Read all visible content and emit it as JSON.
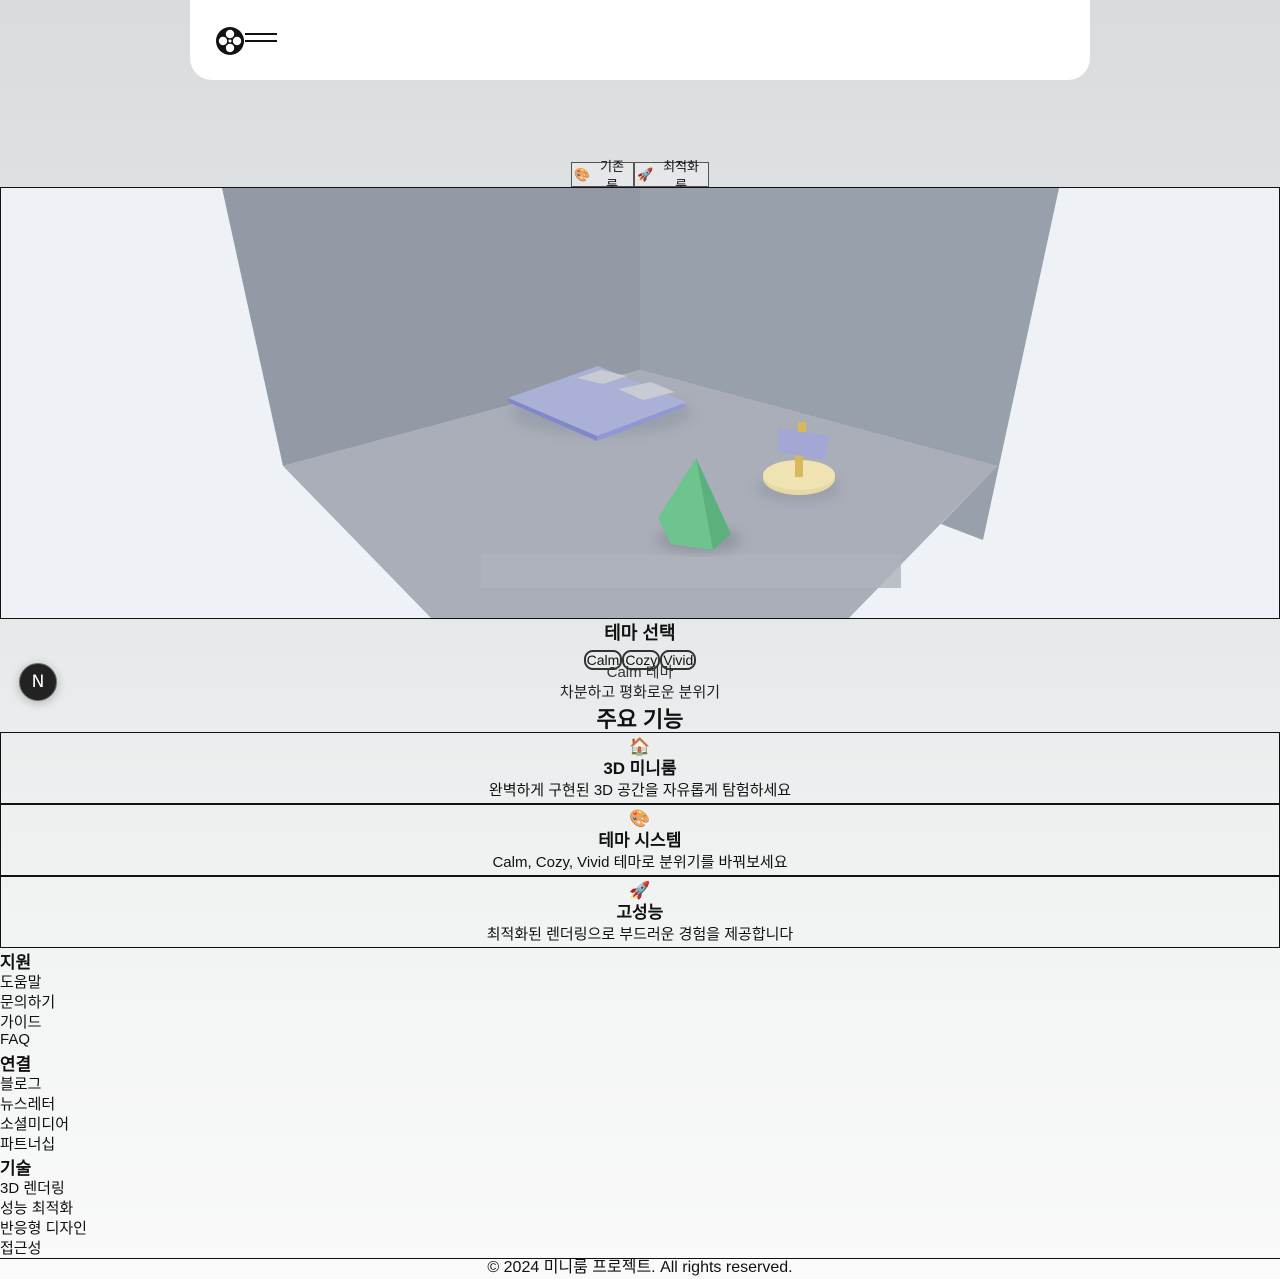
{
  "header": {
    "logo_icon": "film-reel-icon",
    "menu_icon": "hamburger-menu-icon"
  },
  "room_switch": {
    "basic": {
      "icon": "🎨",
      "label": "기존 룸"
    },
    "optimized": {
      "icon": "🚀",
      "label": "최적화 룸"
    }
  },
  "scene": {
    "objects": [
      "bed",
      "cone",
      "lamp"
    ],
    "colors": {
      "wall": "#98a0ac",
      "floor": "#a9aeb8",
      "cone": "#6dc48f",
      "bed": "#aab0d6",
      "lamp_base": "#e7d9a3"
    }
  },
  "theme": {
    "title": "테마 선택",
    "options": [
      "Calm",
      "Cozy",
      "Vivid"
    ],
    "current_name": "Calm 테마",
    "current_desc": "차분하고 평화로운 분위기"
  },
  "badge": {
    "label": "N"
  },
  "features": {
    "title": "주요 기능",
    "items": [
      {
        "icon": "🏠",
        "title": "3D 미니룸",
        "desc": "완벽하게 구현된 3D 공간을 자유롭게 탐험하세요"
      },
      {
        "icon": "🎨",
        "title": "테마 시스템",
        "desc": "Calm, Cozy, Vivid 테마로 분위기를 바꿔보세요"
      },
      {
        "icon": "🚀",
        "title": "고성능",
        "desc": "최적화된 렌더링으로 부드러운 경험을 제공합니다"
      }
    ]
  },
  "footer": {
    "sections": [
      {
        "heading": "지원",
        "links": [
          "도움말",
          "문의하기",
          "가이드",
          "FAQ"
        ]
      },
      {
        "heading": "연결",
        "links": [
          "블로그",
          "뉴스레터",
          "소셜미디어",
          "파트너십"
        ]
      },
      {
        "heading": "기술",
        "links": [
          "3D 렌더링",
          "성능 최적화",
          "반응형 디자인",
          "접근성"
        ]
      }
    ],
    "copyright": "© 2024 미니룸 프로젝트. All rights reserved."
  }
}
